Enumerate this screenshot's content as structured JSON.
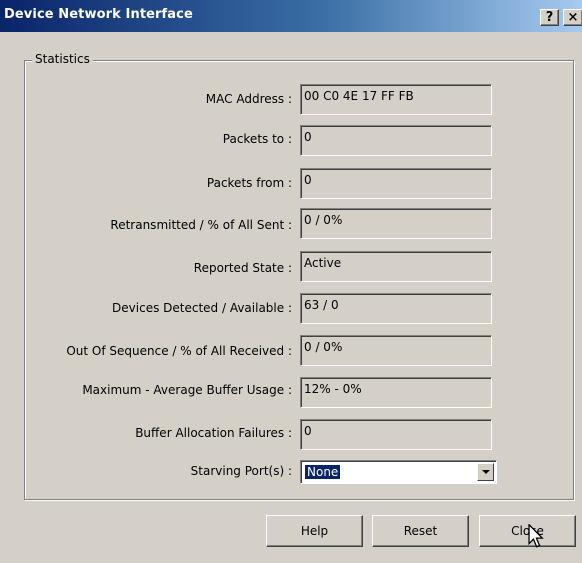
{
  "window": {
    "title": "Device Network Interface",
    "help_button": "?",
    "close_button": "×"
  },
  "statistics": {
    "group_label": "Statistics",
    "rows": [
      {
        "label": "MAC Address :",
        "value": "00 C0 4E 17 FF FB"
      },
      {
        "label": "Packets to :",
        "value": "0"
      },
      {
        "label": "Packets from :",
        "value": "0"
      },
      {
        "label": "Retransmitted / % of All Sent :",
        "value": "0 / 0%"
      },
      {
        "label": "Reported State :",
        "value": "Active"
      },
      {
        "label": "Devices Detected / Available :",
        "value": "63 / 0"
      },
      {
        "label": "Out Of Sequence / % of All Received :",
        "value": "0 / 0%"
      },
      {
        "label": "Maximum - Average Buffer Usage :",
        "value": "12% - 0%"
      },
      {
        "label": "Buffer Allocation Failures :",
        "value": "0"
      }
    ],
    "starving_port": {
      "label": "Starving Port(s) :",
      "selected": "None"
    }
  },
  "buttons": {
    "help": "Help",
    "reset": "Reset",
    "close": "Close"
  }
}
